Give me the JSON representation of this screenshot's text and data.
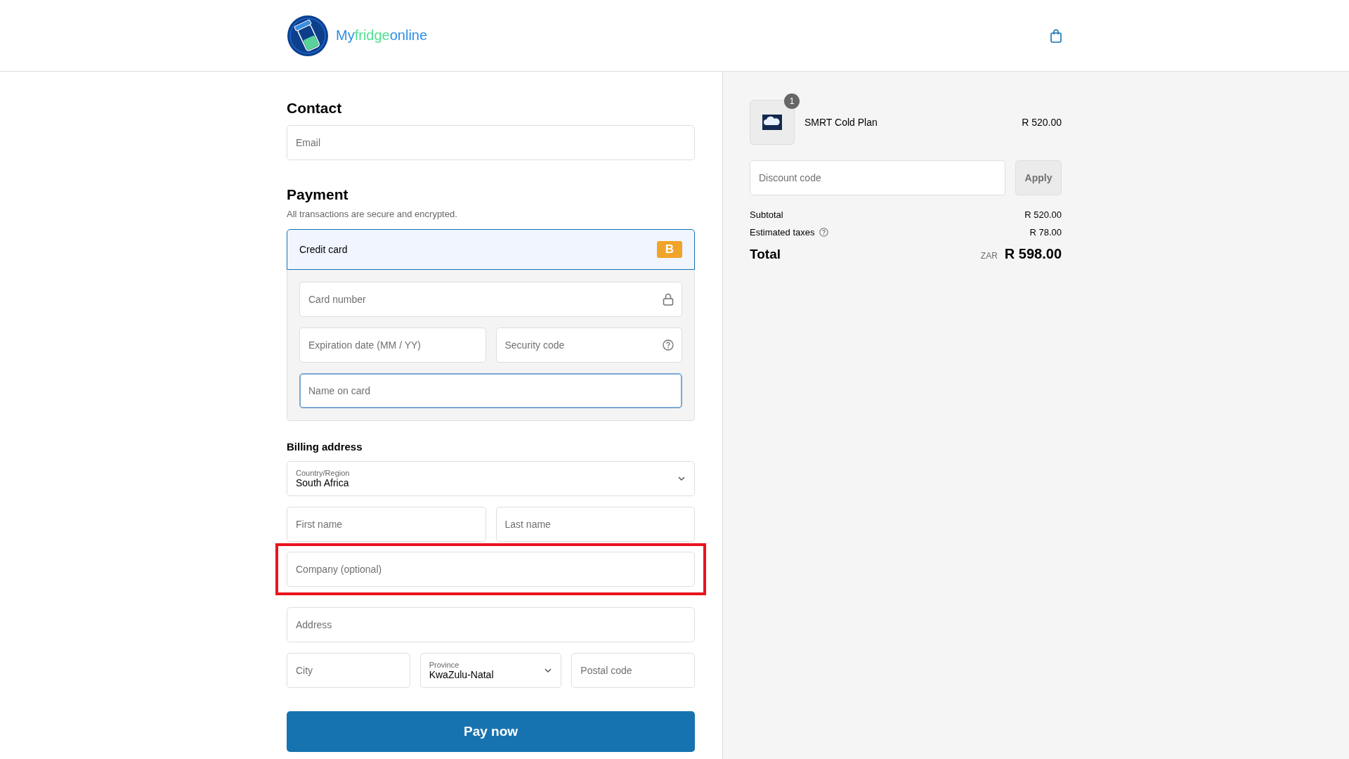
{
  "header": {
    "logo_parts": [
      {
        "text": "My",
        "color": "#2b8fe6"
      },
      {
        "text": "fridge",
        "color": "#4fe08f"
      },
      {
        "text": "online",
        "color": "#2b8fe6"
      }
    ]
  },
  "contact": {
    "title": "Contact",
    "fields": [
      {
        "placeholder": "Email"
      }
    ]
  },
  "payment": {
    "title": "Payment",
    "subtitle": "All transactions are secure and encrypted.",
    "method": {
      "label": "Credit card",
      "badge": "B",
      "selected": true
    },
    "fields": [
      {
        "kind": "secure",
        "placeholder": "Card number",
        "focused": false
      },
      {
        "kind": "plain",
        "placeholder": "Expiration date (MM / YY)",
        "focused": false
      },
      {
        "kind": "help",
        "placeholder": "Security code",
        "focused": false
      },
      {
        "kind": "plain",
        "placeholder": "Name on card",
        "focused": true
      }
    ]
  },
  "billing": {
    "title": "Billing address",
    "rows": [
      [
        {
          "kind": "select",
          "label": "Country/Region",
          "value": "South Africa"
        }
      ],
      [
        {
          "kind": "input",
          "placeholder": "First name"
        },
        {
          "kind": "input",
          "placeholder": "Last name"
        }
      ],
      [
        {
          "kind": "input",
          "placeholder": "Company (optional)",
          "highlighted": true
        }
      ],
      [
        {
          "kind": "input",
          "placeholder": "Address"
        }
      ],
      [
        {
          "kind": "input",
          "placeholder": "City"
        },
        {
          "kind": "select",
          "label": "Province",
          "value": "KwaZulu-Natal"
        },
        {
          "kind": "input",
          "placeholder": "Postal code"
        }
      ]
    ]
  },
  "pay_button": "Pay now",
  "summary": {
    "items": [
      {
        "name": "SMRT Cold Plan",
        "price": "R 520.00",
        "quantity": "1"
      }
    ],
    "discount": {
      "placeholder": "Discount code",
      "button": "Apply"
    },
    "lines": [
      {
        "label": "Subtotal",
        "value": "R 520.00",
        "info": false
      },
      {
        "label": "Estimated taxes",
        "value": "R 78.00",
        "info": true
      }
    ],
    "total": {
      "label": "Total",
      "currency": "ZAR",
      "value": "R 598.00"
    }
  }
}
